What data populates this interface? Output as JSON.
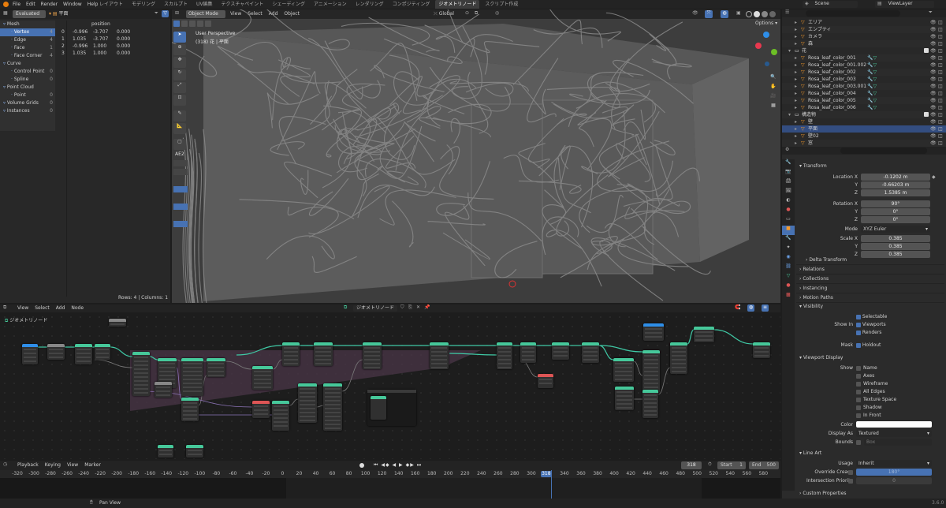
{
  "topbar": {
    "menus": [
      "File",
      "Edit",
      "Render",
      "Window",
      "Help"
    ],
    "workspace_tabs": [
      "レイアウト",
      "モデリング",
      "スカルプト",
      "UV編集",
      "テクスチャペイント",
      "シェーディング",
      "アニメーション",
      "レンダリング",
      "コンポジティング",
      "ジオメトリノード",
      "スクリプト作成"
    ],
    "active_tab_index": 9,
    "scene": "Scene",
    "view_layer": "ViewLayer"
  },
  "spreadsheet": {
    "mode": "Evaluated",
    "object": "平面",
    "column_header": "position",
    "tree": [
      {
        "label": "Mesh",
        "count": ""
      },
      {
        "label": "Vertex",
        "count": "4"
      },
      {
        "label": "Edge",
        "count": "4"
      },
      {
        "label": "Face",
        "count": "1"
      },
      {
        "label": "Face Corner",
        "count": "4"
      },
      {
        "label": "Curve",
        "count": ""
      },
      {
        "label": "Control Point",
        "count": "0"
      },
      {
        "label": "Spline",
        "count": "0"
      },
      {
        "label": "Point Cloud",
        "count": ""
      },
      {
        "label": "Point",
        "count": "0"
      },
      {
        "label": "Volume Grids",
        "count": "0"
      },
      {
        "label": "Instances",
        "count": "0"
      }
    ],
    "rows": [
      [
        "0",
        "-0.996",
        "-3.707",
        "0.000"
      ],
      [
        "1",
        "1.035",
        "-3.707",
        "0.000"
      ],
      [
        "2",
        "-0.996",
        "1.000",
        "0.000"
      ],
      [
        "3",
        "1.035",
        "1.000",
        "0.000"
      ]
    ],
    "footer": "Rows: 4  |  Columns: 1"
  },
  "viewport": {
    "mode": "Object Mode",
    "menus": [
      "View",
      "Select",
      "Add",
      "Object"
    ],
    "orientation": "Global",
    "overlay_title": "User Perspective",
    "overlay_sub": "(318) 花 | 平面",
    "options": "Options",
    "toolpanel_title": "AE2"
  },
  "outliner": {
    "items": [
      {
        "label": "エリア",
        "indent": 1
      },
      {
        "label": "エンプティ",
        "indent": 1
      },
      {
        "label": "カメラ",
        "indent": 1
      },
      {
        "label": "森",
        "indent": 1
      },
      {
        "label": "花",
        "indent": 0
      },
      {
        "label": "Rosa_leaf_color_001",
        "indent": 1
      },
      {
        "label": "Rosa_leaf_color_001.002",
        "indent": 1
      },
      {
        "label": "Rosa_leaf_color_002",
        "indent": 1
      },
      {
        "label": "Rosa_leaf_color_003",
        "indent": 1
      },
      {
        "label": "Rosa_leaf_color_003.001",
        "indent": 1
      },
      {
        "label": "Rosa_leaf_color_004",
        "indent": 1
      },
      {
        "label": "Rosa_leaf_color_005",
        "indent": 1
      },
      {
        "label": "Rosa_leaf_color_006",
        "indent": 1
      },
      {
        "label": "構造物",
        "indent": 0
      },
      {
        "label": "壁",
        "indent": 1
      },
      {
        "label": "平面",
        "indent": 1
      },
      {
        "label": "壁02",
        "indent": 1
      },
      {
        "label": "窓",
        "indent": 1
      }
    ],
    "selected_index": 15
  },
  "properties": {
    "transform_title": "Transform",
    "location": {
      "label": "Location X",
      "x": "-0.1202 m",
      "y": "-0.66203 m",
      "z": "1.5385 m"
    },
    "rotation": {
      "label": "Rotation X",
      "x": "90°",
      "y": "0°",
      "z": "0°"
    },
    "mode_label": "Mode",
    "mode_value": "XYZ Euler",
    "scale": {
      "label": "Scale X",
      "x": "0.385",
      "y": "0.385",
      "z": "0.385"
    },
    "axis_y": "Y",
    "axis_z": "Z",
    "sections": [
      "Delta Transform",
      "Relations",
      "Collections",
      "Instancing",
      "Motion Paths"
    ],
    "visibility_title": "Visibility",
    "selectable": "Selectable",
    "show_in": "Show In",
    "viewports": "Viewports",
    "renders": "Renders",
    "mask": "Mask",
    "holdout": "Holdout",
    "viewport_display_title": "Viewport Display",
    "show_label": "Show",
    "show_items": [
      "Name",
      "Axes",
      "Wireframe",
      "All Edges",
      "Texture Space",
      "Shadow",
      "In Front"
    ],
    "color_label": "Color",
    "display_as_label": "Display As",
    "display_as_value": "Textured",
    "bounds_label": "Bounds",
    "bounds_value": "Box",
    "line_art_title": "Line Art",
    "usage_label": "Usage",
    "usage_value": "Inherit",
    "override_crease_label": "Override Crease",
    "override_crease_value": "180°",
    "intersection_priority_label": "Intersection Priority",
    "intersection_priority_value": "0",
    "custom_properties": "Custom Properties"
  },
  "node_editor": {
    "menus": [
      "View",
      "Select",
      "Add",
      "Node"
    ],
    "tree_name": "ジオメトリノード",
    "breadcrumb": "ジオメトリノード"
  },
  "timeline": {
    "menus": [
      "Playback",
      "Keying",
      "View",
      "Marker"
    ],
    "current_frame": "318",
    "start_label": "Start",
    "start": "1",
    "end_label": "End",
    "end": "500",
    "ticks": [
      "-320",
      "-300",
      "-280",
      "-260",
      "-240",
      "-220",
      "-200",
      "-180",
      "-160",
      "-140",
      "-120",
      "-100",
      "-80",
      "-60",
      "-40",
      "-20",
      "0",
      "20",
      "40",
      "60",
      "80",
      "100",
      "120",
      "140",
      "160",
      "180",
      "200",
      "220",
      "240",
      "260",
      "280",
      "300",
      "318",
      "340",
      "360",
      "380",
      "400",
      "420",
      "440",
      "460",
      "480",
      "500",
      "520",
      "540",
      "560",
      "580"
    ]
  },
  "statusbar": {
    "text": "Pan View",
    "version": "3.6.0"
  },
  "colors": {
    "accent": "#4772b3",
    "node_link": "#3fc9a5",
    "frame_purple": "#4a3647"
  }
}
